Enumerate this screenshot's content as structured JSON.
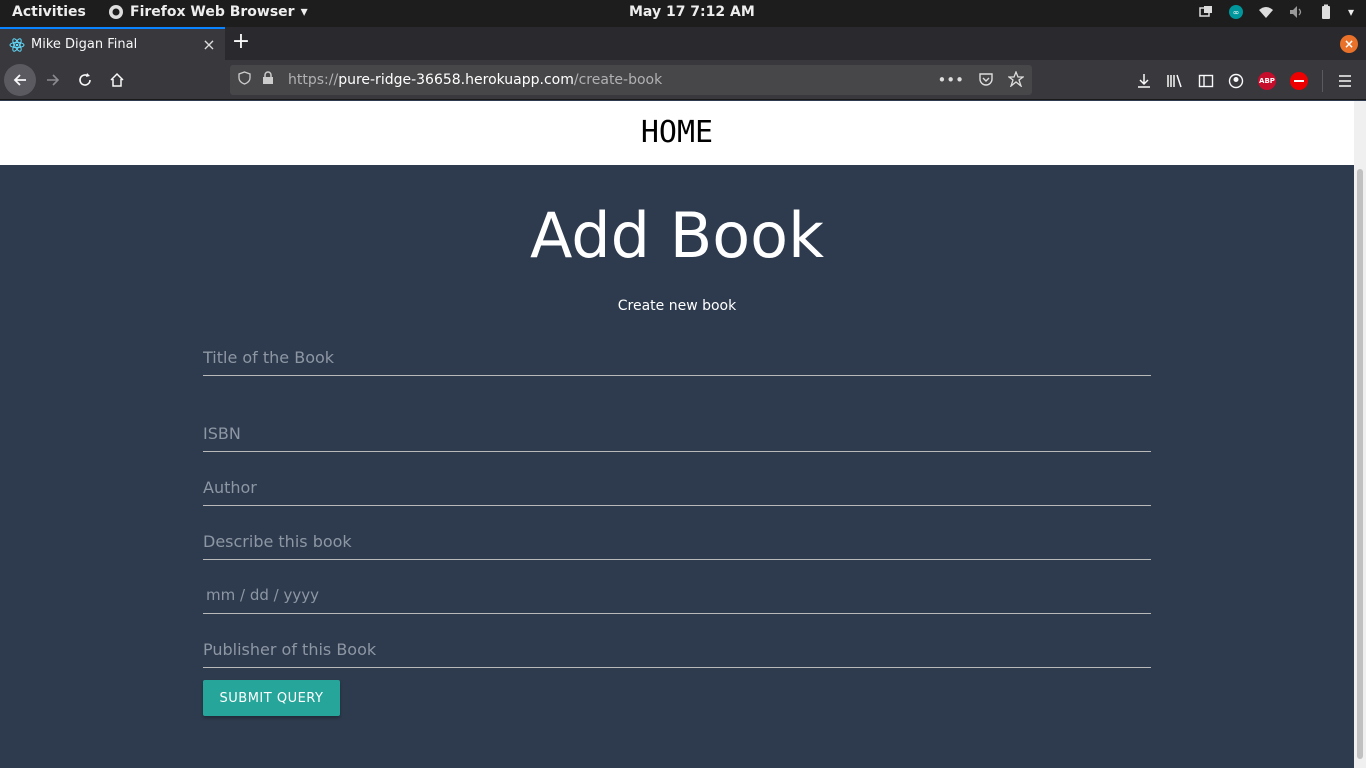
{
  "system_bar": {
    "activities": "Activities",
    "app_name": "Firefox Web Browser",
    "clock": "May 17  7:12 AM"
  },
  "browser": {
    "tab_title": "Mike Digan Final",
    "url_scheme": "https://",
    "url_host": "pure-ridge-36658.herokuapp.com",
    "url_path": "/create-book",
    "new_tab": "+",
    "tab_close": "×",
    "window_close": "×",
    "abp_label": "ABP"
  },
  "nav": {
    "home_link": "HOME"
  },
  "main": {
    "heading": "Add Book",
    "subheading": "Create new book",
    "fields": {
      "title_placeholder": "Title of the Book",
      "isbn_placeholder": "ISBN",
      "author_placeholder": "Author",
      "description_placeholder": "Describe this book",
      "date_placeholder": "mm / dd / yyyy",
      "publisher_placeholder": "Publisher of this Book"
    },
    "submit_label": "SUBMIT QUERY"
  },
  "colors": {
    "page_background": "#2e3b4e",
    "submit_button": "#26a69a",
    "tab_accent": "#0a84ff"
  }
}
